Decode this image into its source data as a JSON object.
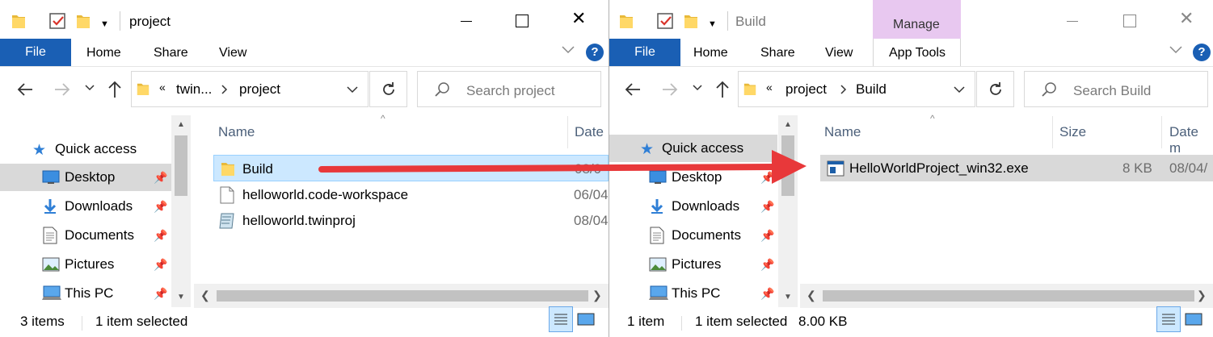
{
  "left": {
    "title": "project",
    "tabs": {
      "file": "File",
      "home": "Home",
      "share": "Share",
      "view": "View"
    },
    "breadcrumb": {
      "separator": "«",
      "parent": "twin...",
      "current": "project"
    },
    "search_placeholder": "Search project",
    "columns": {
      "name": "Name",
      "date": "Date"
    },
    "nav": {
      "quick_access": "Quick access",
      "items": [
        "Desktop",
        "Downloads",
        "Documents",
        "Pictures",
        "This PC"
      ]
    },
    "files": [
      {
        "name": "Build",
        "date": "08/0"
      },
      {
        "name": "helloworld.code-workspace",
        "date": "06/04"
      },
      {
        "name": "helloworld.twinproj",
        "date": "08/04"
      }
    ],
    "status": {
      "count": "3 items",
      "selected": "1 item selected"
    }
  },
  "right": {
    "title": "Build",
    "contextual_tab": "Manage",
    "tabs": {
      "file": "File",
      "home": "Home",
      "share": "Share",
      "view": "View",
      "app_tools": "App Tools"
    },
    "breadcrumb": {
      "separator": "«",
      "parent": "project",
      "current": "Build"
    },
    "search_placeholder": "Search Build",
    "columns": {
      "name": "Name",
      "size": "Size",
      "date": "Date m"
    },
    "nav": {
      "quick_access": "Quick access",
      "items": [
        "Desktop",
        "Downloads",
        "Documents",
        "Pictures",
        "This PC"
      ]
    },
    "files": [
      {
        "name": "HelloWorldProject_win32.exe",
        "size": "8 KB",
        "date": "08/04/"
      }
    ],
    "status": {
      "count": "1 item",
      "selected": "1 item selected",
      "size": "8.00 KB"
    }
  },
  "colors": {
    "file_tab": "#1a5fb4",
    "selection": "#cce8ff",
    "manage_tab": "#e8c8f0",
    "arrow": "#e8383a"
  },
  "icons": [
    "folder-icon",
    "checkmark-icon",
    "search-icon",
    "refresh-icon",
    "pin-icon",
    "star-icon",
    "desktop-icon",
    "downloads-icon",
    "documents-icon",
    "pictures-icon",
    "pc-icon",
    "exe-icon"
  ]
}
